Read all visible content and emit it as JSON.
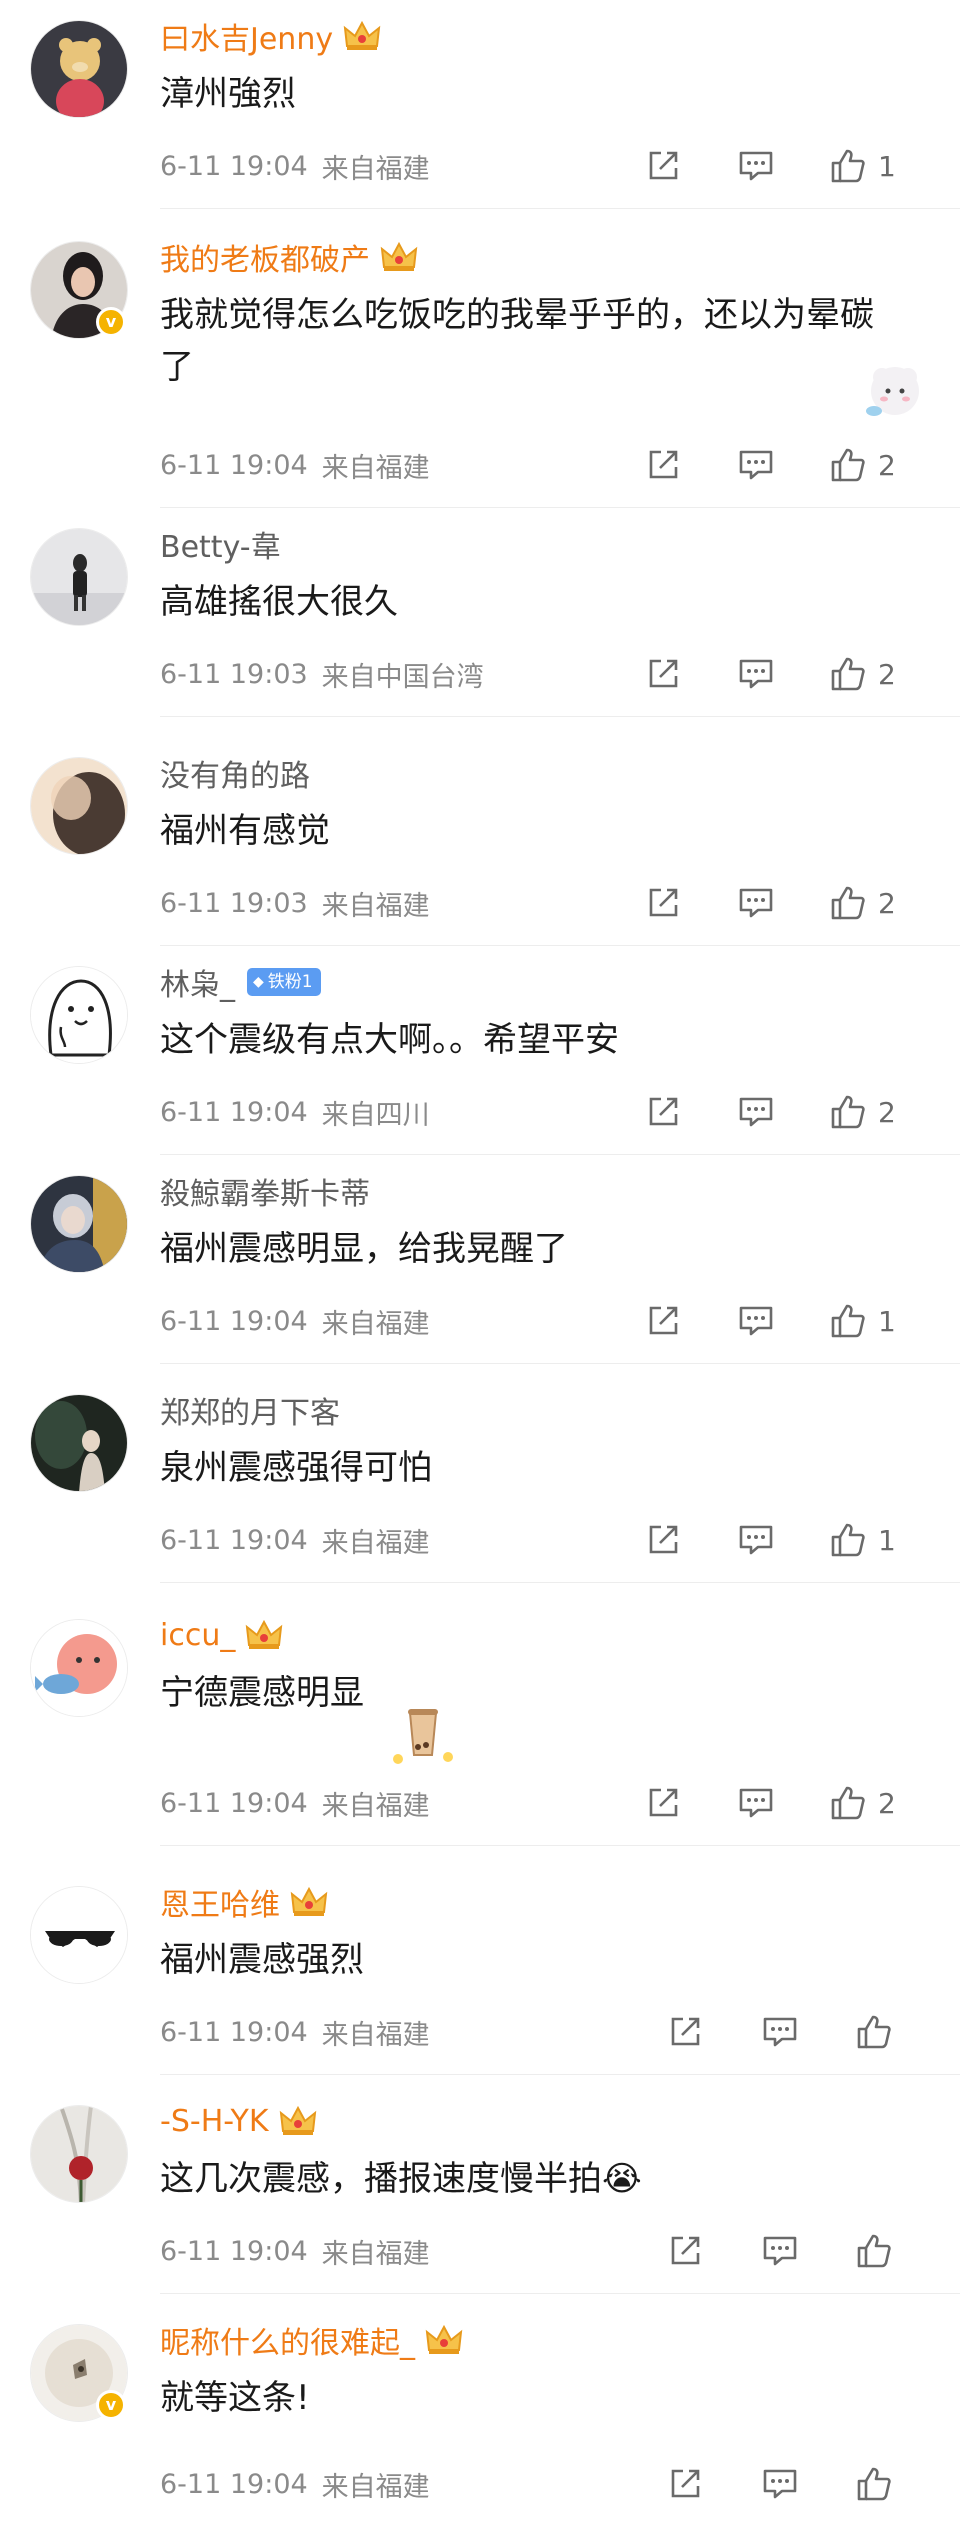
{
  "comments": [
    {
      "name": "曰水吉Jenny",
      "vip": true,
      "text": "漳州強烈",
      "time": "6-11 19:04",
      "location": "来自福建",
      "likes": "1"
    },
    {
      "name": "我的老板都破产",
      "vip": true,
      "text": "我就觉得怎么吃饭吃的我晕乎乎的，还以为晕碳了",
      "time": "6-11 19:04",
      "location": "来自福建",
      "likes": "2"
    },
    {
      "name": "Betty-韋",
      "vip": false,
      "text": "高雄搖很大很久",
      "time": "6-11 19:03",
      "location": "来自中国台湾",
      "likes": "2"
    },
    {
      "name": "没有角的路",
      "vip": false,
      "text": "福州有感觉",
      "time": "6-11 19:03",
      "location": "来自福建",
      "likes": "2"
    },
    {
      "name": "林枭_",
      "vip": false,
      "fan_badge": "铁粉1",
      "text": "这个震级有点大啊。。希望平安",
      "time": "6-11 19:04",
      "location": "来自四川",
      "likes": "2"
    },
    {
      "name": "殺鯨霸拳斯卡蒂",
      "vip": false,
      "text": "福州震感明显，给我晃醒了",
      "time": "6-11 19:04",
      "location": "来自福建",
      "likes": "1"
    },
    {
      "name": "郑郑的月下客",
      "vip": false,
      "text": "泉州震感强得可怕",
      "time": "6-11 19:04",
      "location": "来自福建",
      "likes": "1"
    },
    {
      "name": "iccu_",
      "vip": true,
      "text": "宁德震感明显",
      "time": "6-11 19:04",
      "location": "来自福建",
      "likes": "2"
    },
    {
      "name": "恩王哈维",
      "vip": true,
      "text": "福州震感强烈",
      "time": "6-11 19:04",
      "location": "来自福建",
      "likes": ""
    },
    {
      "name": "-S-H-YK",
      "vip": true,
      "text": "这几次震感，播报速度慢半拍😭",
      "time": "6-11 19:04",
      "location": "来自福建",
      "likes": ""
    },
    {
      "name": "昵称什么的很难起_",
      "vip": true,
      "text": "就等这条!",
      "time": "6-11 19:04",
      "location": "来自福建",
      "likes": ""
    }
  ],
  "icons": {
    "repost": "share-icon",
    "comment": "comment-icon",
    "like": "thumbs-up-icon",
    "crown": "vip-crown-icon",
    "verified": "verified-badge-icon"
  },
  "colors": {
    "vip_name": "#ef7b16",
    "plain_name": "#5f5f5f",
    "text": "#1a1a1a",
    "meta": "#8a8a8a",
    "fan_badge": "#5b9cf2",
    "verified_badge": "#f5b300"
  }
}
